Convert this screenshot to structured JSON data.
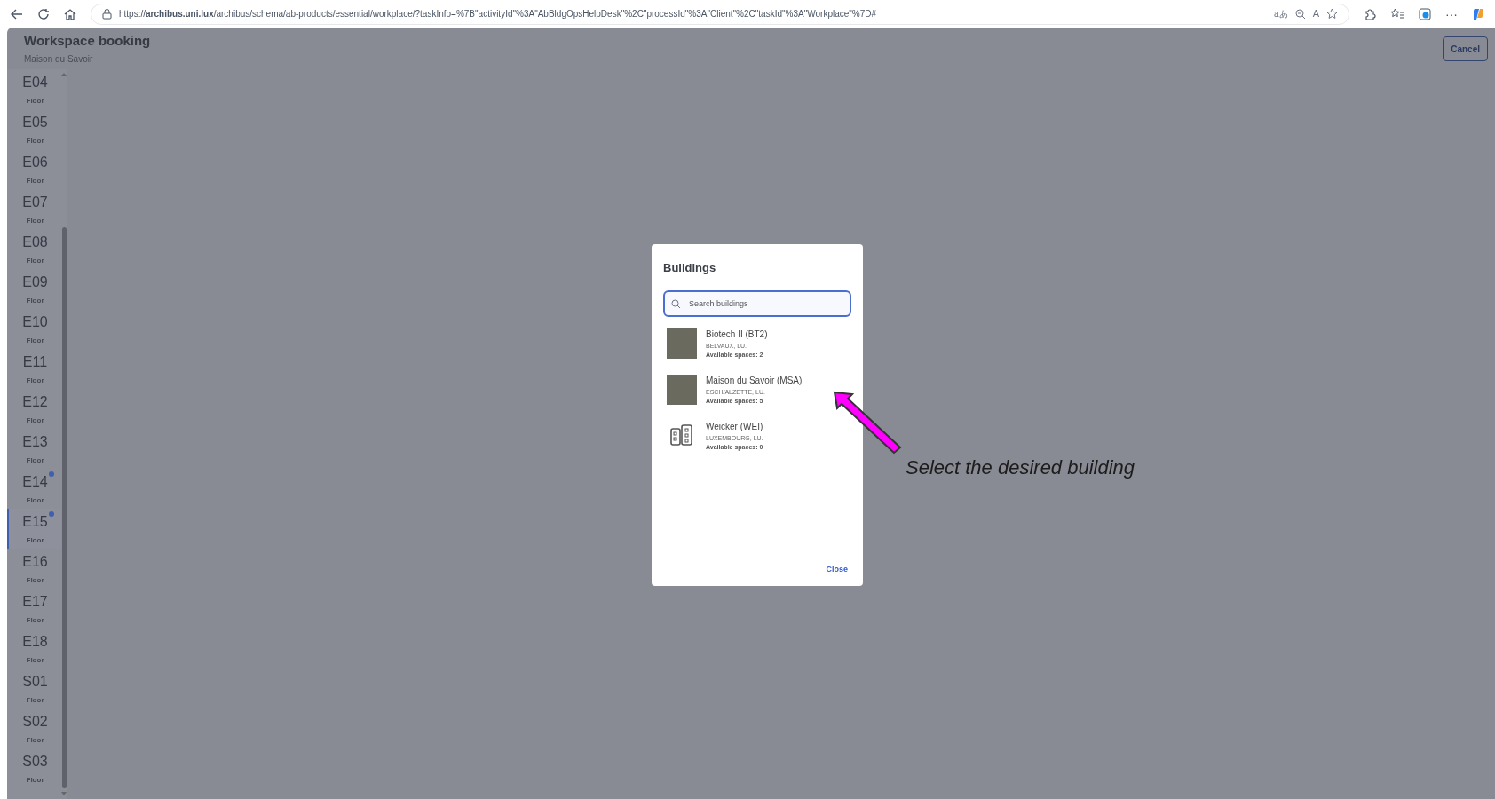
{
  "browser": {
    "url": "https://**archibus.uni.lux**/archibus/schema/ab-products/essential/workplace/?taskInfo=%7B\"activityId\"%3A\"AbBldgOpsHelpDesk\"%2C\"processId\"%3A\"Client\"%2C\"taskId\"%3A\"Workplace\"%7D#",
    "translate_glyph": "aあ",
    "read_aloud_glyph": "A",
    "more_glyph": "···"
  },
  "header": {
    "title": "Workspace booking",
    "subtitle": "Maison du Savoir",
    "cancel_button": "Cancel"
  },
  "floors": [
    {
      "code": "E04",
      "label": "Floor",
      "badge": false,
      "selected": false
    },
    {
      "code": "E05",
      "label": "Floor",
      "badge": false,
      "selected": false
    },
    {
      "code": "E06",
      "label": "Floor",
      "badge": false,
      "selected": false
    },
    {
      "code": "E07",
      "label": "Floor",
      "badge": false,
      "selected": false
    },
    {
      "code": "E08",
      "label": "Floor",
      "badge": false,
      "selected": false
    },
    {
      "code": "E09",
      "label": "Floor",
      "badge": false,
      "selected": false
    },
    {
      "code": "E10",
      "label": "Floor",
      "badge": false,
      "selected": false
    },
    {
      "code": "E11",
      "label": "Floor",
      "badge": false,
      "selected": false
    },
    {
      "code": "E12",
      "label": "Floor",
      "badge": false,
      "selected": false
    },
    {
      "code": "E13",
      "label": "Floor",
      "badge": false,
      "selected": false
    },
    {
      "code": "E14",
      "label": "Floor",
      "badge": true,
      "selected": false
    },
    {
      "code": "E15",
      "label": "Floor",
      "badge": true,
      "selected": true
    },
    {
      "code": "E16",
      "label": "Floor",
      "badge": false,
      "selected": false
    },
    {
      "code": "E17",
      "label": "Floor",
      "badge": false,
      "selected": false
    },
    {
      "code": "E18",
      "label": "Floor",
      "badge": false,
      "selected": false
    },
    {
      "code": "S01",
      "label": "Floor",
      "badge": false,
      "selected": false
    },
    {
      "code": "S02",
      "label": "Floor",
      "badge": false,
      "selected": false
    },
    {
      "code": "S03",
      "label": "Floor",
      "badge": false,
      "selected": false
    }
  ],
  "dialog": {
    "title": "Buildings",
    "search": {
      "placeholder": "Search buildings"
    },
    "buildings": [
      {
        "kind": "photo",
        "name": "Biotech II (BT2)",
        "location": "BELVAUX, LU.",
        "availability": "Available spaces: 2"
      },
      {
        "kind": "photo",
        "name": "Maison du Savoir (MSA)",
        "location": "ESCH/ALZETTE, LU.",
        "availability": "Available spaces: 5"
      },
      {
        "kind": "icon",
        "name": "Weicker (WEI)",
        "location": "LUXEMBOURG, LU.",
        "availability": "Available spaces: 0"
      }
    ],
    "close_button": "Close"
  },
  "annotation": {
    "text": "Select the desired building"
  }
}
